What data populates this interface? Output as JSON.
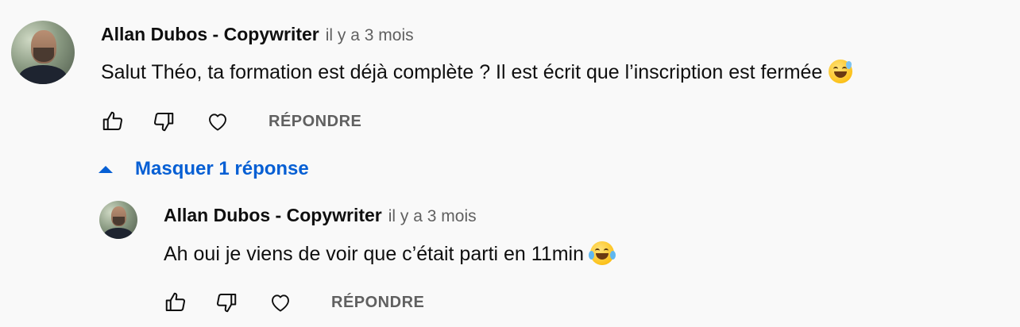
{
  "comment": {
    "author": "Allan Dubos - Copywriter",
    "time": "il y a 3 mois",
    "text": "Salut Théo, ta formation est déjà complète ? Il est écrit que l’inscription est fermée",
    "emoji": "sweat-smile-emoji",
    "actions": {
      "like_icon": "thumbs-up-icon",
      "dislike_icon": "thumbs-down-icon",
      "heart_icon": "heart-icon",
      "reply_label": "RÉPONDRE"
    }
  },
  "replies_toggle": {
    "label": "Masquer 1 réponse",
    "icon": "caret-up-icon"
  },
  "reply": {
    "author": "Allan Dubos - Copywriter",
    "time": "il y a 3 mois",
    "text": "Ah oui je viens de voir que c’était parti en 11min",
    "emoji": "tears-of-joy-emoji",
    "actions": {
      "like_icon": "thumbs-up-icon",
      "dislike_icon": "thumbs-down-icon",
      "heart_icon": "heart-icon",
      "reply_label": "RÉPONDRE"
    }
  },
  "colors": {
    "background": "#f9f9f9",
    "link_blue": "#065fd4",
    "secondary_text": "#606060"
  }
}
